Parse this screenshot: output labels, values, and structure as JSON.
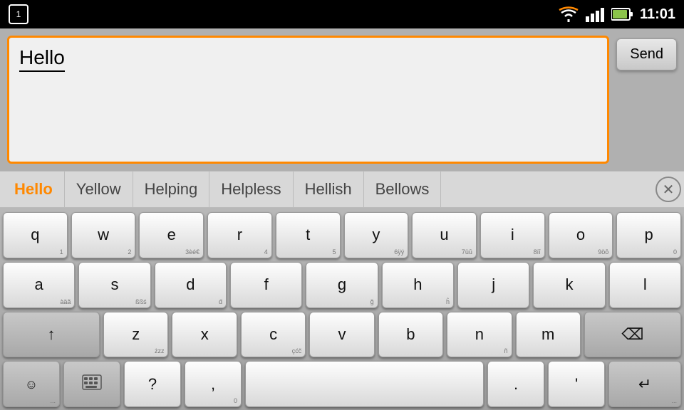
{
  "statusBar": {
    "notificationNum": "1",
    "time": "11:01"
  },
  "inputArea": {
    "textValue": "Hello",
    "sendLabel": "Send"
  },
  "suggestions": {
    "items": [
      "Hello",
      "Yellow",
      "Helping",
      "Helpless",
      "Hellish",
      "Bellows"
    ],
    "dismissIcon": "✕"
  },
  "keyboard": {
    "row1": [
      {
        "main": "q",
        "sub": "1"
      },
      {
        "main": "w",
        "sub": "2"
      },
      {
        "main": "e",
        "sub": "3èé€"
      },
      {
        "main": "r",
        "sub": "4"
      },
      {
        "main": "t",
        "sub": "5"
      },
      {
        "main": "y",
        "sub": "6ÿý"
      },
      {
        "main": "u",
        "sub": "7üū"
      },
      {
        "main": "i",
        "sub": "8ïī"
      },
      {
        "main": "o",
        "sub": "9öō"
      },
      {
        "main": "p",
        "sub": "0"
      }
    ],
    "row2": [
      {
        "main": "a",
        "sub": "àäã"
      },
      {
        "main": "s",
        "sub": "ßßś"
      },
      {
        "main": "d",
        "sub": "ḋ"
      },
      {
        "main": "f",
        "sub": ""
      },
      {
        "main": "g",
        "sub": "ğ"
      },
      {
        "main": "h",
        "sub": "ĥ"
      },
      {
        "main": "j",
        "sub": ""
      },
      {
        "main": "k",
        "sub": ""
      },
      {
        "main": "l",
        "sub": ""
      }
    ],
    "row3": [
      {
        "main": "↑",
        "sub": "",
        "type": "shift"
      },
      {
        "main": "z",
        "sub": "żzz"
      },
      {
        "main": "x",
        "sub": ""
      },
      {
        "main": "c",
        "sub": "çćč"
      },
      {
        "main": "v",
        "sub": ""
      },
      {
        "main": "b",
        "sub": ""
      },
      {
        "main": "n",
        "sub": "ñ"
      },
      {
        "main": "m",
        "sub": ""
      },
      {
        "main": "⌫",
        "sub": "",
        "type": "backspace"
      }
    ],
    "row4": [
      {
        "main": "☺",
        "sub": "...",
        "type": "emoji"
      },
      {
        "main": "⌨",
        "sub": "",
        "type": "layout"
      },
      {
        "main": "?",
        "sub": ""
      },
      {
        "main": ",",
        "sub": "0"
      },
      {
        "main": " ",
        "sub": "",
        "type": "space"
      },
      {
        "main": ".",
        "sub": ""
      },
      {
        "main": "'",
        "sub": ""
      },
      {
        "main": "↵",
        "sub": "...",
        "type": "enter"
      }
    ]
  }
}
